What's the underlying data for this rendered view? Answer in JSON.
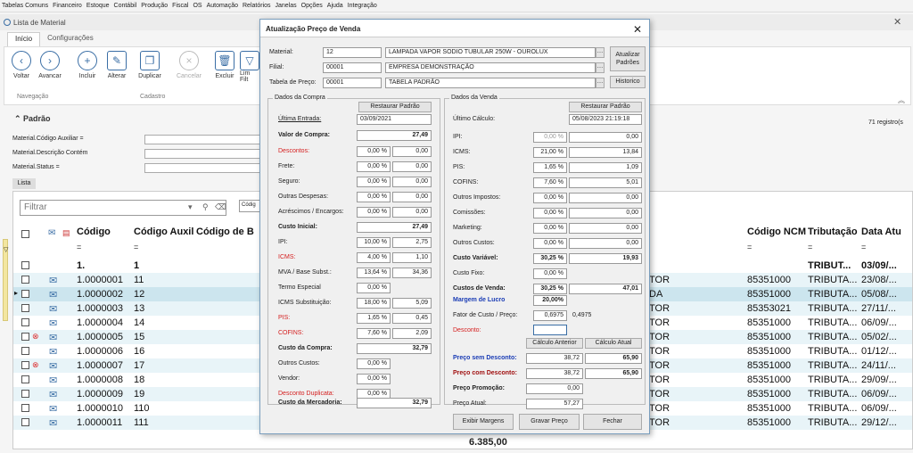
{
  "menu": [
    "Tabelas Comuns",
    "Financeiro",
    "Estoque",
    "Contábil",
    "Produção",
    "Fiscal",
    "OS",
    "Automação",
    "Relatórios",
    "Janelas",
    "Opções",
    "Ajuda",
    "Integração"
  ],
  "window": {
    "title": "Lista de Material",
    "close": "✕"
  },
  "ribbon_tabs": [
    "Início",
    "Configurações"
  ],
  "ribbon": {
    "voltar": "Voltar",
    "avancar": "Avancar",
    "incluir": "Incluir",
    "alterar": "Alterar",
    "duplicar": "Duplicar",
    "cancelar": "Cancelar",
    "excluir": "Excluir",
    "lim1": "Lim",
    "lim2": "Filt",
    "group_nav": "Navegação",
    "group_cad": "Cadastro"
  },
  "section_title": "Padrão",
  "filters": [
    "Material.Código Auxiliar =",
    "Material.Descrição Contém",
    "Material.Status ="
  ],
  "registros": "71 registro(s",
  "lista_tab": "Lista",
  "filtro_placeholder": "Filtrar",
  "codigo_chip": "Códig",
  "grid_headers": {
    "codigo": "Código",
    "auxil": "Código Auxil",
    "codb": "Código de B",
    "ncm": "Código NCM",
    "trib": "Tributação",
    "data": "Data Atu"
  },
  "rows": [
    {
      "codigo": "1.",
      "aux": "1",
      "ncm": "",
      "trib": "TRIBUT...",
      "data": "03/09/...",
      "mid": ""
    },
    {
      "codigo": "1.0000001",
      "aux": "11",
      "ncm": "85351000",
      "trib": "TRIBUTA...",
      "data": "23/08/...",
      "mid": "TOR"
    },
    {
      "codigo": "1.0000002",
      "aux": "12",
      "ncm": "85351000",
      "trib": "TRIBUTA...",
      "data": "05/08/...",
      "mid": "DA"
    },
    {
      "codigo": "1.0000003",
      "aux": "13",
      "ncm": "85353021",
      "trib": "TRIBUTA...",
      "data": "27/11/...",
      "mid": "TOR"
    },
    {
      "codigo": "1.0000004",
      "aux": "14",
      "ncm": "85351000",
      "trib": "TRIBUTA...",
      "data": "06/09/...",
      "mid": "TOR"
    },
    {
      "codigo": "1.0000005",
      "aux": "15",
      "ncm": "85351000",
      "trib": "TRIBUTA...",
      "data": "05/02/...",
      "mid": "TOR"
    },
    {
      "codigo": "1.0000006",
      "aux": "16",
      "ncm": "85351000",
      "trib": "TRIBUTA...",
      "data": "01/12/...",
      "mid": "TOR"
    },
    {
      "codigo": "1.0000007",
      "aux": "17",
      "ncm": "85351000",
      "trib": "TRIBUTA...",
      "data": "24/11/...",
      "mid": "TOR"
    },
    {
      "codigo": "1.0000008",
      "aux": "18",
      "ncm": "85351000",
      "trib": "TRIBUTA...",
      "data": "29/09/...",
      "mid": "TOR"
    },
    {
      "codigo": "1.0000009",
      "aux": "19",
      "ncm": "85351000",
      "trib": "TRIBUTA...",
      "data": "06/09/...",
      "mid": "TOR"
    },
    {
      "codigo": "1.0000010",
      "aux": "110",
      "ncm": "85351000",
      "trib": "TRIBUTA...",
      "data": "06/09/...",
      "mid": "TOR"
    },
    {
      "codigo": "1.0000011",
      "aux": "111",
      "ncm": "85351000",
      "trib": "TRIBUTA...",
      "data": "29/12/...",
      "mid": "TOR"
    }
  ],
  "total": "6.385,00",
  "dialog": {
    "title": "Atualização Preço de Venda",
    "material_label": "Material:",
    "material_code": "12",
    "material_desc": "LAMPADA VAPOR SODIO TUBULAR 250W - OUROLUX",
    "filial_label": "Filial:",
    "filial_code": "00001",
    "filial_desc": "EMPRESA DEMONSTRAÇÃO",
    "tabela_label": "Tabela de Preço:",
    "tabela_code": "00001",
    "tabela_desc": "TABELA PADRÃO",
    "btn_atualizar1": "Atualizar",
    "btn_atualizar2": "Padrões",
    "btn_historico": "Historico",
    "compra_title": "Dados da Compra",
    "venda_title": "Dados da Venda",
    "restaurar": "Restaurar Padrão",
    "compra": {
      "ultima_label": "Última Entrada:",
      "ultima": "03/09/2021",
      "valor_label": "Valor de Compra:",
      "valor": "27,49",
      "descontos": "Descontos:",
      "frete": "Frete:",
      "seguro": "Seguro:",
      "outras": "Outras Despesas:",
      "acresc": "Acréscimos / Encargos:",
      "zero_pct": "0,00 %",
      "zero": "0,00",
      "custo_ini_label": "Custo Inicial:",
      "custo_ini": "27,49",
      "ipi_label": "IPI:",
      "ipi_pct": "10,00 %",
      "ipi": "2,75",
      "icms_label": "ICMS:",
      "icms_pct": "4,00 %",
      "icms": "1,10",
      "mva_label": "MVA / Base Subst.:",
      "mva_pct": "13,64 %",
      "mva": "34,36",
      "termo_label": "Termo Especial",
      "termo_pct": "0,00 %",
      "icmsst_label": "ICMS Substituição:",
      "icmsst_pct": "18,00 %",
      "icmsst": "5,09",
      "pis_label": "PIS:",
      "pis_pct": "1,65 %",
      "pis": "0,45",
      "cofins_label": "COFINS:",
      "cofins_pct": "7,60 %",
      "cofins": "2,09",
      "custo_compra_label": "Custo da Compra:",
      "custo_compra": "32,79",
      "outros_custos": "Outros Custos:",
      "vendor": "Vendor:",
      "desc_dup": "Desconto Duplicata:",
      "custo_merc_label": "Custo da Mercadoria:",
      "custo_merc": "32,79"
    },
    "venda": {
      "ultimo_label": "Último Cálculo:",
      "ultimo": "05/08/2023 21:19:18",
      "ipi_label": "IPI:",
      "ipi_pct": "0,00 %",
      "ipi": "0,00",
      "icms_label": "ICMS:",
      "icms_pct": "21,00 %",
      "icms": "13,84",
      "pis_label": "PIS:",
      "pis_pct": "1,65 %",
      "pis": "1,09",
      "cofins_label": "COFINS:",
      "cofins_pct": "7,60 %",
      "cofins": "5,01",
      "outros_imp": "Outros Impostos:",
      "comissoes": "Comissões:",
      "marketing": "Marketing:",
      "outros_custos": "Outros Custos:",
      "zero_pct": "0,00 %",
      "zero": "0,00",
      "custo_var_label": "Custo Variável:",
      "custo_var_pct": "30,25 %",
      "custo_var": "19,93",
      "custo_fixo_label": "Custo Fixo:",
      "custo_fixo_pct": "0,00 %",
      "custos_venda_label": "Custos de Venda:",
      "custos_venda_pct": "30,25 %",
      "custos_venda": "47,01",
      "margem_label": "Margem de Lucro",
      "margem_pct": "20,00%",
      "fator_label": "Fator de Custo / Preço:",
      "fator1": "0,6975",
      "fator2": "0,4975",
      "desconto_label": "Desconto:",
      "calc_ant": "Cálculo Anterior",
      "calc_atual": "Cálculo Atual",
      "psd_label": "Preço sem Desconto:",
      "psd_ant": "38,72",
      "psd_atual": "65,90",
      "pcd_label": "Preço com Desconto:",
      "pcd_ant": "38,72",
      "pcd_atual": "65,90",
      "promo_label": "Preço Promoção:",
      "promo": "0,00",
      "atual_label": "Preço Atual:",
      "atual": "57,27"
    },
    "btn_exibir": "Exibir Margens",
    "btn_gravar": "Gravar Preço",
    "btn_fechar": "Fechar"
  }
}
